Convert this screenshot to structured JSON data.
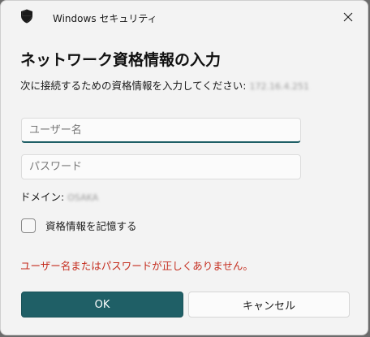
{
  "window": {
    "app_title": "Windows セキュリティ",
    "close_icon": "close-icon",
    "app_icon": "shield-icon"
  },
  "dialog": {
    "heading": "ネットワーク資格情報の入力",
    "subtitle": "次に接続するための資格情報を入力してください:",
    "server_address": "172.16.4.251"
  },
  "form": {
    "username_placeholder": "ユーザー名",
    "password_placeholder": "パスワード",
    "domain_label": "ドメイン:",
    "domain_value": "OSAKA",
    "remember_label": "資格情報を記憶する",
    "remember_checked": false
  },
  "error": {
    "message": "ユーザー名またはパスワードが正しくありません。"
  },
  "buttons": {
    "ok_label": "OK",
    "cancel_label": "キャンセル"
  },
  "colors": {
    "accent": "#1f5f66",
    "error": "#c42b1c",
    "background": "#f3f3f3"
  }
}
